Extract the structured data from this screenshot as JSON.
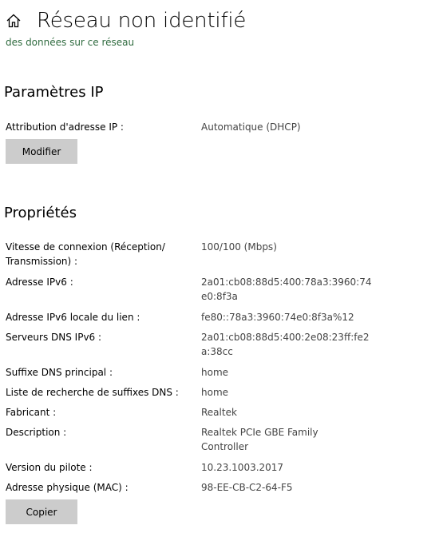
{
  "header": {
    "title": "Réseau non identifié",
    "icon": "home-icon",
    "subtitle": "des données sur ce réseau"
  },
  "ip_settings": {
    "section_title": "Paramètres IP",
    "assignment_label": "Attribution d'adresse IP :",
    "assignment_value": "Automatique (DHCP)",
    "edit_button": "Modifier"
  },
  "properties": {
    "section_title": "Propriétés",
    "rows": [
      {
        "label": "Vitesse de connexion (Réception/ Transmission) :",
        "value": "100/100 (Mbps)"
      },
      {
        "label": "Adresse IPv6 :",
        "value": "2a01:cb08:88d5:400:78a3:3960:74e0:8f3a"
      },
      {
        "label": "Adresse IPv6 locale du lien :",
        "value": "fe80::78a3:3960:74e0:8f3a%12"
      },
      {
        "label": "Serveurs DNS IPv6 :",
        "value": "2a01:cb08:88d5:400:2e08:23ff:fe2a:38cc"
      },
      {
        "label": "Suffixe DNS principal :",
        "value": "home"
      },
      {
        "label": "Liste de recherche de suffixes DNS :",
        "value": "home"
      },
      {
        "label": "Fabricant :",
        "value": "Realtek"
      },
      {
        "label": "Description :",
        "value": "Realtek PCIe GBE Family Controller"
      },
      {
        "label": "Version du pilote :",
        "value": "10.23.1003.2017"
      },
      {
        "label": "Adresse physique (MAC) :",
        "value": "98-EE-CB-C2-64-F5"
      }
    ],
    "copy_button": "Copier"
  }
}
